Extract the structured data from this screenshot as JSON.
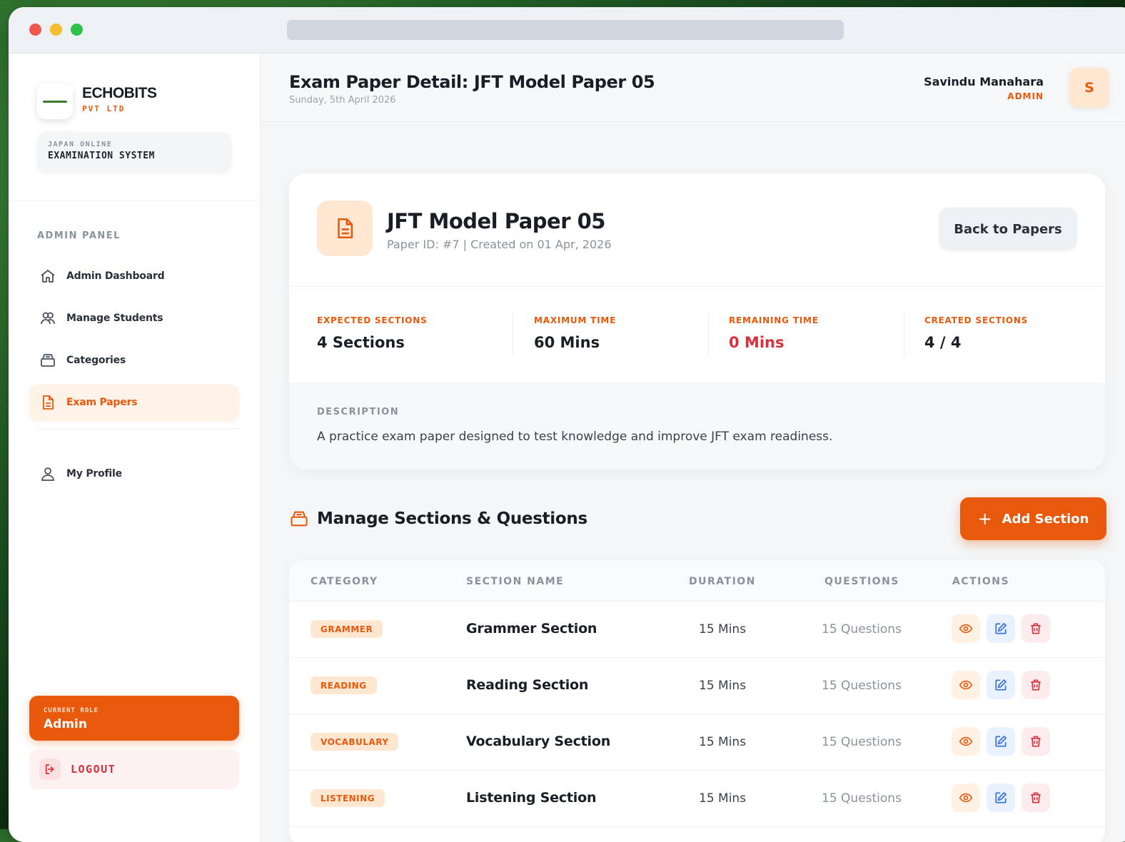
{
  "brand": {
    "name": "ECHOBITS",
    "sub": "PVT LTD"
  },
  "system": {
    "line1": "JAPAN ONLINE",
    "line2": "EXAMINATION SYSTEM"
  },
  "sidebar": {
    "panel_label": "ADMIN PANEL",
    "items": [
      {
        "label": "Admin Dashboard",
        "icon": "home-icon"
      },
      {
        "label": "Manage Students",
        "icon": "users-icon"
      },
      {
        "label": "Categories",
        "icon": "box-icon"
      },
      {
        "label": "Exam Papers",
        "icon": "document-icon",
        "active": true
      },
      {
        "label": "My Profile",
        "icon": "user-icon"
      }
    ],
    "role_label": "CURRENT ROLE",
    "role_value": "Admin",
    "logout_label": "LOGOUT"
  },
  "header": {
    "title": "Exam Paper Detail: JFT Model Paper 05",
    "date": "Sunday, 5th April 2026",
    "user_name": "Savindu Manahara",
    "user_role": "ADMIN",
    "avatar_letter": "S"
  },
  "paper": {
    "name": "JFT Model Paper 05",
    "meta": "Paper ID: #7 | Created on 01 Apr, 2026",
    "back_label": "Back to Papers",
    "stats": [
      {
        "label": "EXPECTED SECTIONS",
        "value": "4 Sections"
      },
      {
        "label": "MAXIMUM TIME",
        "value": "60 Mins"
      },
      {
        "label": "REMAINING TIME",
        "value": "0 Mins"
      },
      {
        "label": "CREATED SECTIONS",
        "value": "4 / 4"
      }
    ],
    "description_label": "DESCRIPTION",
    "description": "A practice exam paper designed to test knowledge and improve JFT exam readiness."
  },
  "sections": {
    "title": "Manage Sections & Questions",
    "add_label": "Add Section",
    "columns": [
      "CATEGORY",
      "SECTION NAME",
      "DURATION",
      "QUESTIONS",
      "ACTIONS"
    ],
    "rows": [
      {
        "category": "GRAMMER",
        "name": "Grammer Section",
        "duration": "15 Mins",
        "questions": "15 Questions"
      },
      {
        "category": "READING",
        "name": "Reading Section",
        "duration": "15 Mins",
        "questions": "15 Questions"
      },
      {
        "category": "VOCABULARY",
        "name": "Vocabulary Section",
        "duration": "15 Mins",
        "questions": "15 Questions"
      },
      {
        "category": "LISTENING",
        "name": "Listening Section",
        "duration": "15 Mins",
        "questions": "15 Questions"
      }
    ]
  },
  "colors": {
    "accent": "#e8590c",
    "accent_soft": "#ffe7d2",
    "danger": "#dc2f3b",
    "edit_blue": "#2f6fe0"
  }
}
